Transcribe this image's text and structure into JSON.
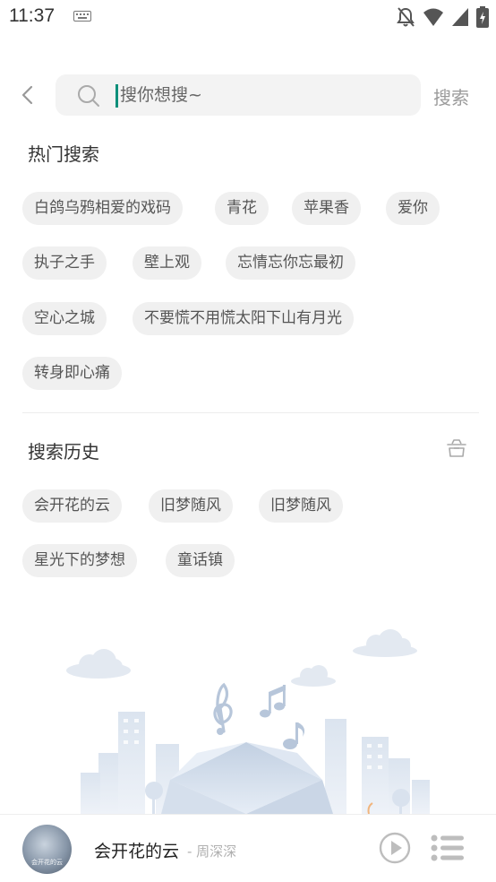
{
  "status_bar": {
    "time": "11:37"
  },
  "search": {
    "placeholder": "搜你想搜~",
    "button_label": "搜索"
  },
  "hot": {
    "title": "热门搜索",
    "tags": [
      "白鸽乌鸦相爱的戏码",
      "青花",
      "苹果香",
      "爱你",
      "执子之手",
      "壁上观",
      "忘情忘你忘最初",
      "空心之城",
      "不要慌不用慌太阳下山有月光",
      "转身即心痛"
    ]
  },
  "history": {
    "title": "搜索历史",
    "tags": [
      "会开花的云",
      "旧梦随风",
      "旧梦随风",
      "星光下的梦想",
      "童话镇"
    ]
  },
  "player": {
    "song_title": "会开花的云",
    "artist": "- 周深深",
    "album_text": "会开花的云"
  },
  "colors": {
    "caret": "#0d8f7a",
    "tag_bg": "#f0f0f0",
    "illustration": "#c9d6e6"
  }
}
